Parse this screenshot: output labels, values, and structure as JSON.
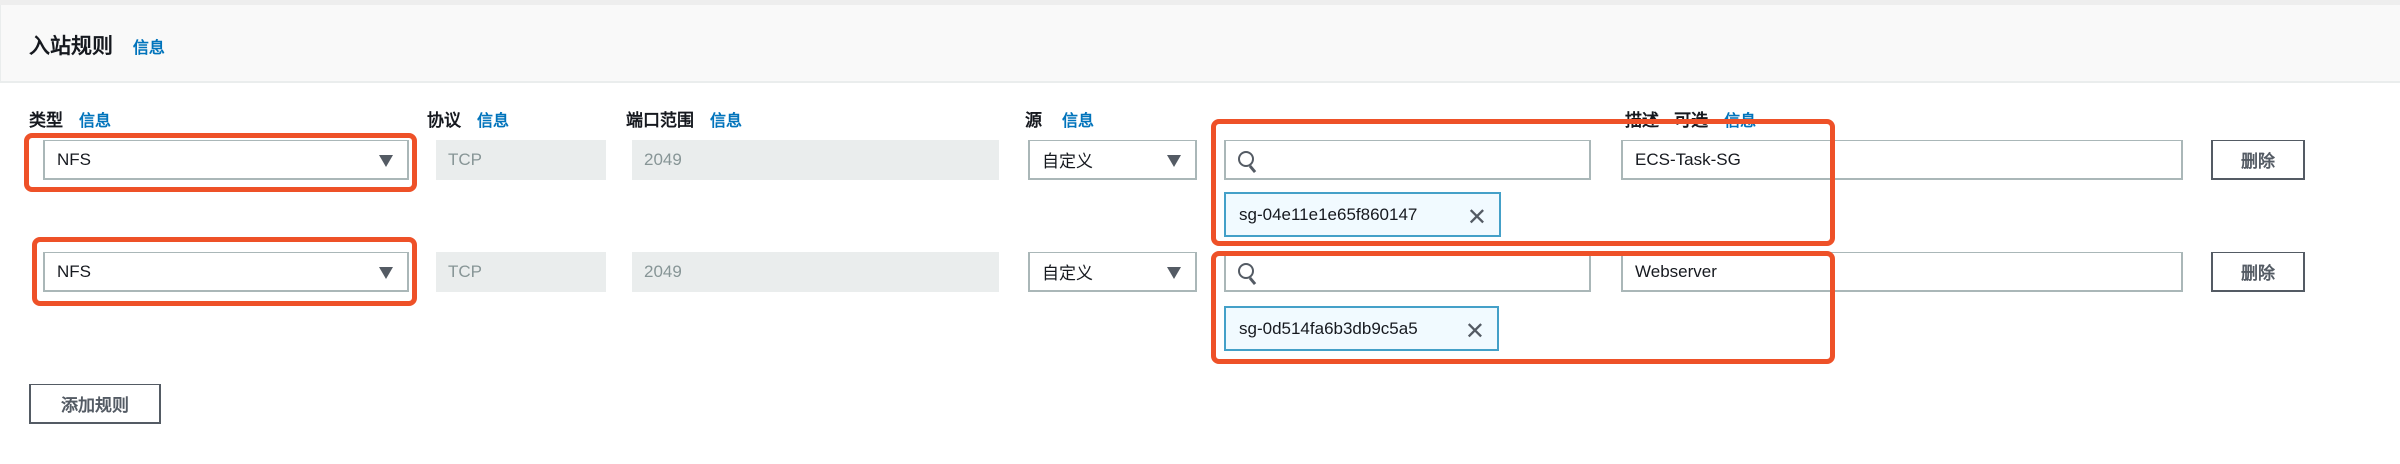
{
  "section": {
    "title": "入站规则",
    "info": "信息"
  },
  "columns": {
    "type": {
      "label": "类型",
      "info": "信息"
    },
    "protocol": {
      "label": "协议",
      "info": "信息"
    },
    "port_range": {
      "label": "端口范围",
      "info": "信息"
    },
    "source": {
      "label": "源",
      "info": "信息"
    },
    "description": {
      "label": "描述 - 可选",
      "info": "信息"
    }
  },
  "rules": [
    {
      "type": "NFS",
      "protocol": "TCP",
      "port_range": "2049",
      "source": "自定义",
      "search_value": "",
      "chip": "sg-04e11e1e65f860147",
      "description": "ECS-Task-SG",
      "delete": "删除"
    },
    {
      "type": "NFS",
      "protocol": "TCP",
      "port_range": "2049",
      "source": "自定义",
      "search_value": "",
      "chip": "sg-0d514fa6b3db9c5a5",
      "description": "Webserver",
      "delete": "删除"
    }
  ],
  "add_rule": "添加规则",
  "colors": {
    "link": "#0073bb",
    "highlight": "#ee5128",
    "chip_border": "#44a0c8"
  },
  "chip_remove_icon": "✕"
}
